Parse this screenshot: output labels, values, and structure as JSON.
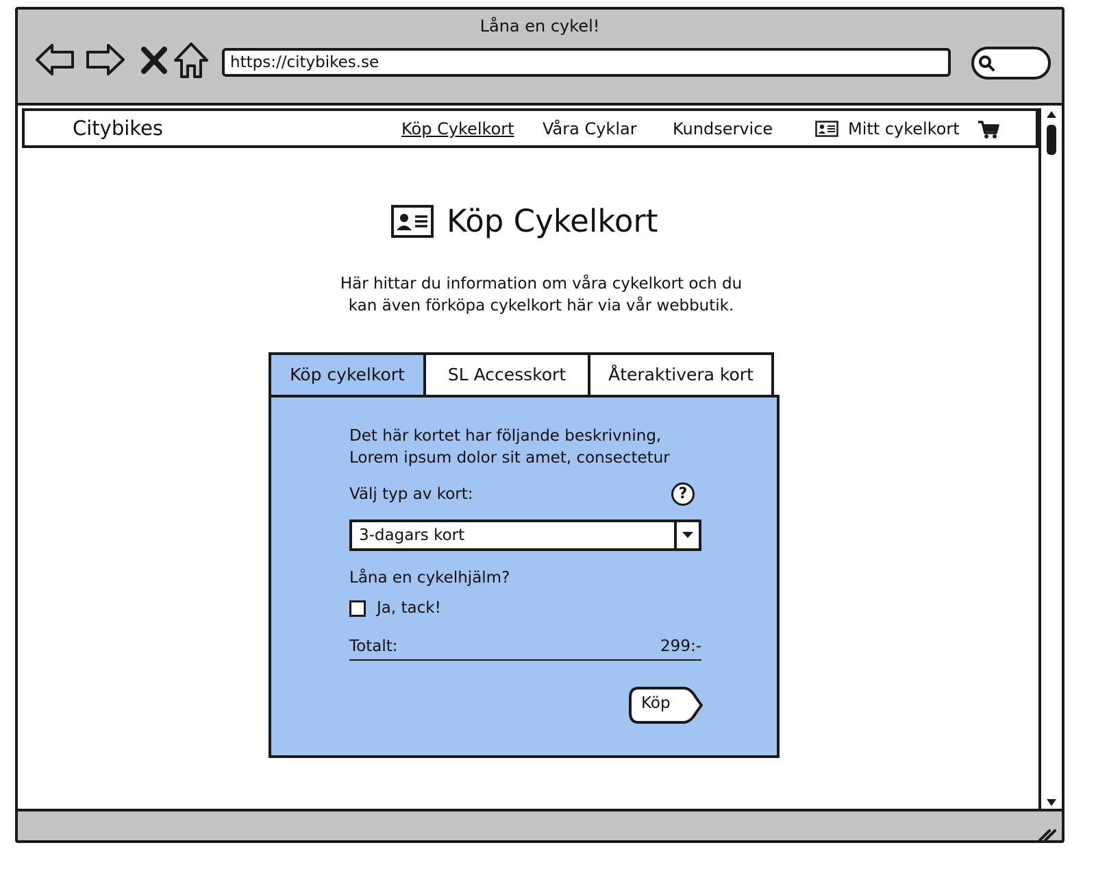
{
  "browser": {
    "window_title": "Låna en cykel!",
    "url": "https://citybikes.se",
    "nav_icons": [
      "back-arrow-icon",
      "forward-arrow-icon",
      "close-icon",
      "home-icon"
    ],
    "search_icon": "search-icon"
  },
  "navbar": {
    "brand": "Citybikes",
    "links": [
      "Köp Cykelkort",
      "Våra Cyklar",
      "Kundservice"
    ],
    "my_card": "Mitt cykelkort",
    "my_card_icon": "id-card-icon",
    "cart_icon": "shopping-cart-icon",
    "active_link": "Köp Cykelkort"
  },
  "main": {
    "heading": "Köp Cykelkort",
    "heading_icon": "id-card-icon",
    "intro_line1": "Här hittar du information om våra cykelkort och du",
    "intro_line2": "kan även förköpa cykelkort här via vår webbutik."
  },
  "tabs": {
    "items": [
      "Köp cykelkort",
      "SL Accesskort",
      "Återaktivera kort"
    ],
    "active_index": 0
  },
  "panel": {
    "desc_line1": "Det här kortet har följande beskrivning,",
    "desc_line2": "Lorem ipsum dolor sit amet, consectetur",
    "type_label": "Välj typ av kort:",
    "help_symbol": "?",
    "selected_type": "3-dagars kort",
    "helmet_question": "Låna en cykelhjälm?",
    "helmet_option": "Ja, tack!",
    "helmet_checked": false,
    "total_label": "Totalt:",
    "total_value": "299:-",
    "buy_label": "Köp"
  },
  "colors": {
    "panel_bg": "#a2c4f2",
    "chrome_bg": "#c4c4c4",
    "stroke": "#1a1a1a"
  }
}
